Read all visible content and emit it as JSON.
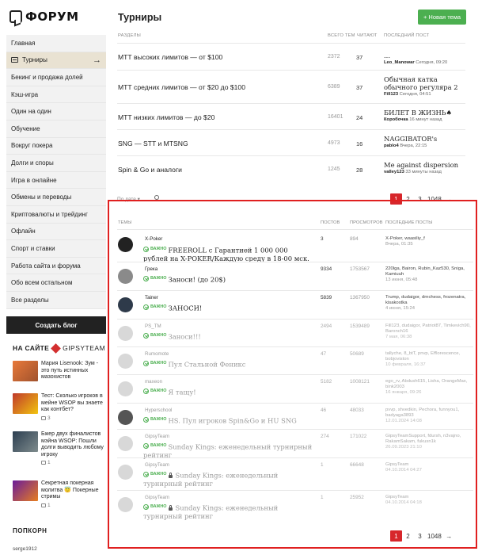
{
  "logo": {
    "text": "ФОРУМ"
  },
  "sidebar": {
    "items": [
      {
        "label": "Главная"
      },
      {
        "label": "Турниры",
        "active": true
      },
      {
        "label": "Бекинг и продажа долей"
      },
      {
        "label": "Кэш-игра"
      },
      {
        "label": "Один на один"
      },
      {
        "label": "Обучение"
      },
      {
        "label": "Вокруг покера"
      },
      {
        "label": "Долги и споры"
      },
      {
        "label": "Игра в онлайне"
      },
      {
        "label": "Обмены и переводы"
      },
      {
        "label": "Криптовалюты и трейдинг"
      },
      {
        "label": "Офлайн"
      },
      {
        "label": "Спорт и ставки"
      },
      {
        "label": "Работа сайта и форума"
      },
      {
        "label": "Обо всем остальном"
      },
      {
        "label": "Все разделы"
      }
    ],
    "blog_button": "Создать блог",
    "onsite_label": "НА САЙТЕ",
    "onsite_brand": "GIPSYTEAM",
    "news": [
      {
        "title": "Мария Lisenook: Зум - это путь истинных мазохистов",
        "comments": ""
      },
      {
        "title": "Тест: Сколько игроков в мейне WSOP вы знаете как контбет?",
        "comments": "3"
      },
      {
        "title": "Бжер двух финалистов мэйна WSOP: Пошли долги выводить любому игроку",
        "comments": "1"
      },
      {
        "title": "Секретная покерная молитва 😇 Покерные стримы",
        "comments": "1"
      }
    ],
    "popcorn_label": "ПОПКОРН",
    "popcorn_user": "serge1912"
  },
  "header": {
    "title": "Турниры",
    "new_topic": "+ Новая тема"
  },
  "sections": {
    "headers": {
      "name": "РАЗДЕЛЫ",
      "topics": "ВСЕГО ТЕМ",
      "reading": "ЧИТАЮТ",
      "last": "ПОСЛЕДНИЙ ПОСТ"
    },
    "rows": [
      {
        "name": "МТТ высоких лимитов — от $100",
        "topics": "2372",
        "reading": "37",
        "last_title": "...",
        "last_user": "Leo_Manowar",
        "last_time": "Сегодня, 09:20"
      },
      {
        "name": "МТТ средних лимитов — от $20 до $100",
        "topics": "6389",
        "reading": "37",
        "last_title": "Обычная катка обычного регуляра 2",
        "last_user": "Fill123",
        "last_time": "Сегодня, 04:51"
      },
      {
        "name": "МТТ низких лимитов — до $20",
        "topics": "16401",
        "reading": "24",
        "last_title": "БИЛЕТ В ЖИЗНЬ♠",
        "last_user": "Коробочка",
        "last_time": "16 минут назад"
      },
      {
        "name": "SNG — STT и MTSNG",
        "topics": "4973",
        "reading": "16",
        "last_title": "NAGGIBATOR's",
        "last_user": "pablo4",
        "last_time": "Вчера, 22:15"
      },
      {
        "name": "Spin & Go и аналоги",
        "topics": "1245",
        "reading": "28",
        "last_title": "Me against dispersion",
        "last_user": "valley123",
        "last_time": "33 минуты назад"
      }
    ]
  },
  "sort": {
    "label": "По дате ▾"
  },
  "pager_top": [
    "1",
    "2",
    "3",
    "1048",
    "→"
  ],
  "topics": {
    "headers": {
      "name": "ТЕМЫ",
      "posts": "ПОСТОВ",
      "views": "ПРОСМОТРОВ",
      "last": "ПОСЛЕДНИЕ ПОСТЫ"
    },
    "important": "ВАЖНО",
    "rows": [
      {
        "author": "X-Poker",
        "title": "FREEROLL с Гарантией 1 000 000 рублей на X-POKER/Каждую среду в 18-00 мск.",
        "posts": "3",
        "views": "894",
        "last_users": "X-Poker, waasiliy_f",
        "last_date": "Вчера, 01:35"
      },
      {
        "author": "Грека",
        "title": "Заноси! (до 20$)",
        "posts": "9334",
        "views": "1753567",
        "last_users": "220lga, Bairon, Rubin_Kaz530, Sniga, Kamiuuh",
        "last_date": "13 июня, 05:48"
      },
      {
        "author": "Tainer",
        "title": "ЗАНОСИ!",
        "posts": "5839",
        "views": "1367950",
        "last_users": "Trump, dudaigor, drnchess, frozenatra, kisakostka",
        "last_date": "4 июня, 15:24"
      },
      {
        "author": "PS_TM",
        "title": "Заноси!!!",
        "posts": "2494",
        "views": "1539489",
        "last_users": "Fill123, dudaigor, Patriot87, Timkevich90, Baronch16",
        "last_date": "7 мая, 06:38"
      },
      {
        "author": "Rumomote",
        "title": "Пул Стальной Феникс",
        "posts": "47",
        "views": "50689",
        "last_users": "tallyche, 8_btT, pnvp, Efflorescence, bobjoviston",
        "last_date": "10 февраля, 16:37"
      },
      {
        "author": "maxeon",
        "title": "Я тащу!",
        "posts": "5182",
        "views": "1008121",
        "last_users": "ego_rv, Abdush615, Lisha, OrangeMax, bink2003",
        "last_date": "16 января, 09:26"
      },
      {
        "author": "Hyperschool",
        "title": "HS. Пул игроков Spin&Go и HU SNG",
        "posts": "46",
        "views": "48033",
        "last_users": "pvvp, shvedkin, Pechora, funnyou1, badyaga3893",
        "last_date": "12.01.2024 14:08"
      },
      {
        "author": "GipsyTeam",
        "title": "Sunday Kings: еженедельный турнирный рейтинг",
        "posts": "274",
        "views": "171022",
        "last_users": "GipsyTeamSupport, fdursh, n3vajno, RakamSakam, fukusn1k",
        "last_date": "26.09.2023 21:10"
      },
      {
        "author": "GipsyTeam",
        "title": "Sunday Kings: еженедельный турнирный рейтинг",
        "posts": "1",
        "views": "66648",
        "last_users": "GipsyTeam",
        "last_date": "04.10.2014 04:27"
      },
      {
        "author": "GipsyTeam",
        "title": "Sunday Kings: еженедельный турнирный рейтинг",
        "posts": "1",
        "views": "25952",
        "last_users": "GipsyTeam",
        "last_date": "04.10.2014 04:18"
      }
    ]
  },
  "pager_bottom": [
    "1",
    "2",
    "3",
    "1048",
    "→"
  ]
}
